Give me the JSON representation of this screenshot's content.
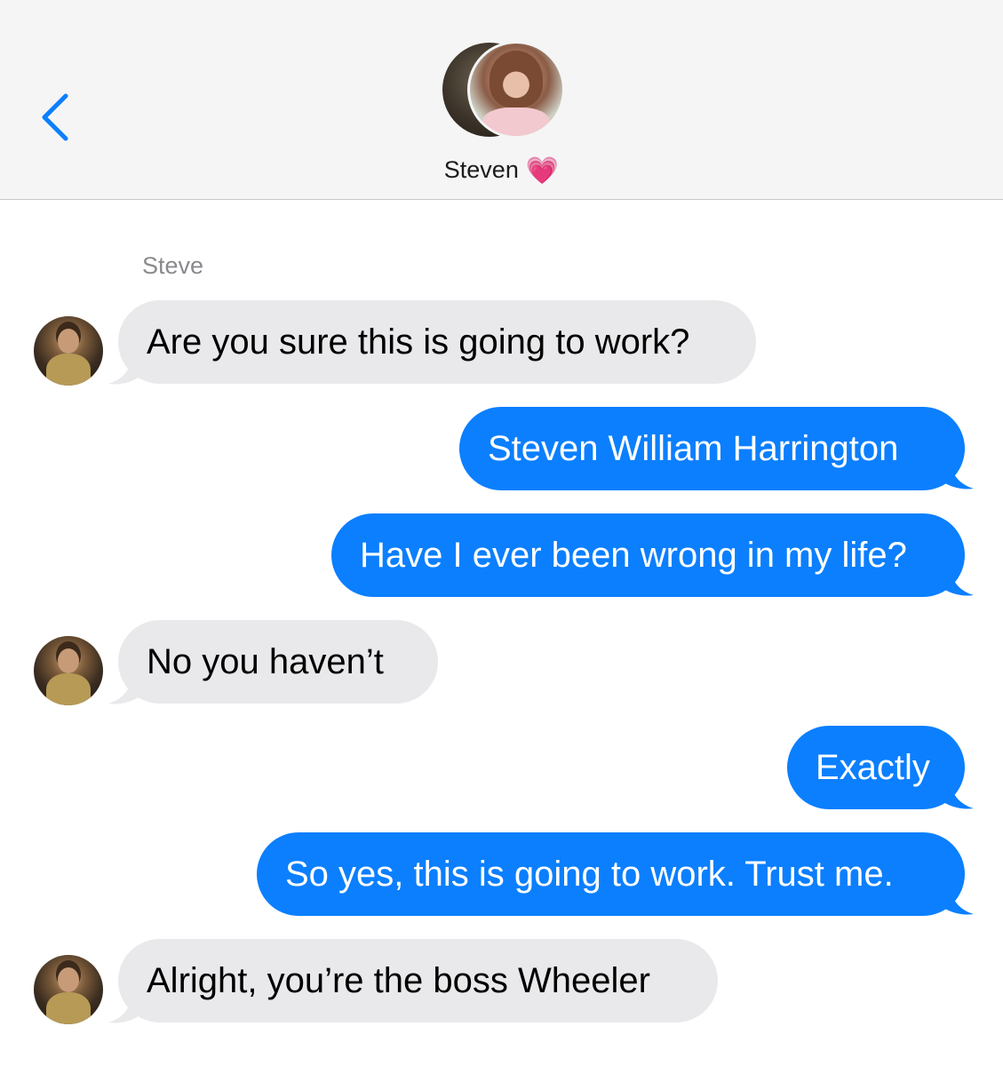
{
  "header": {
    "contact_name": "Steven",
    "contact_emoji": "💗",
    "back_icon": "chevron-left-icon",
    "accent_color": "#0b7ffe"
  },
  "thread": {
    "sender_label": "Steve",
    "messages": [
      {
        "direction": "incoming",
        "text": "Are you sure this is going to work?"
      },
      {
        "direction": "outgoing",
        "text": "Steven William Harrington"
      },
      {
        "direction": "outgoing",
        "text": "Have I ever been wrong in my life?"
      },
      {
        "direction": "incoming",
        "text": "No you haven’t"
      },
      {
        "direction": "outgoing",
        "text": "Exactly"
      },
      {
        "direction": "outgoing",
        "text": "So yes, this is going to work. Trust me."
      },
      {
        "direction": "incoming",
        "text": "Alright, you’re the boss Wheeler"
      }
    ]
  },
  "colors": {
    "incoming_bubble": "#e9e9eb",
    "outgoing_bubble": "#0b7ffe",
    "header_bg": "#f5f5f6"
  }
}
